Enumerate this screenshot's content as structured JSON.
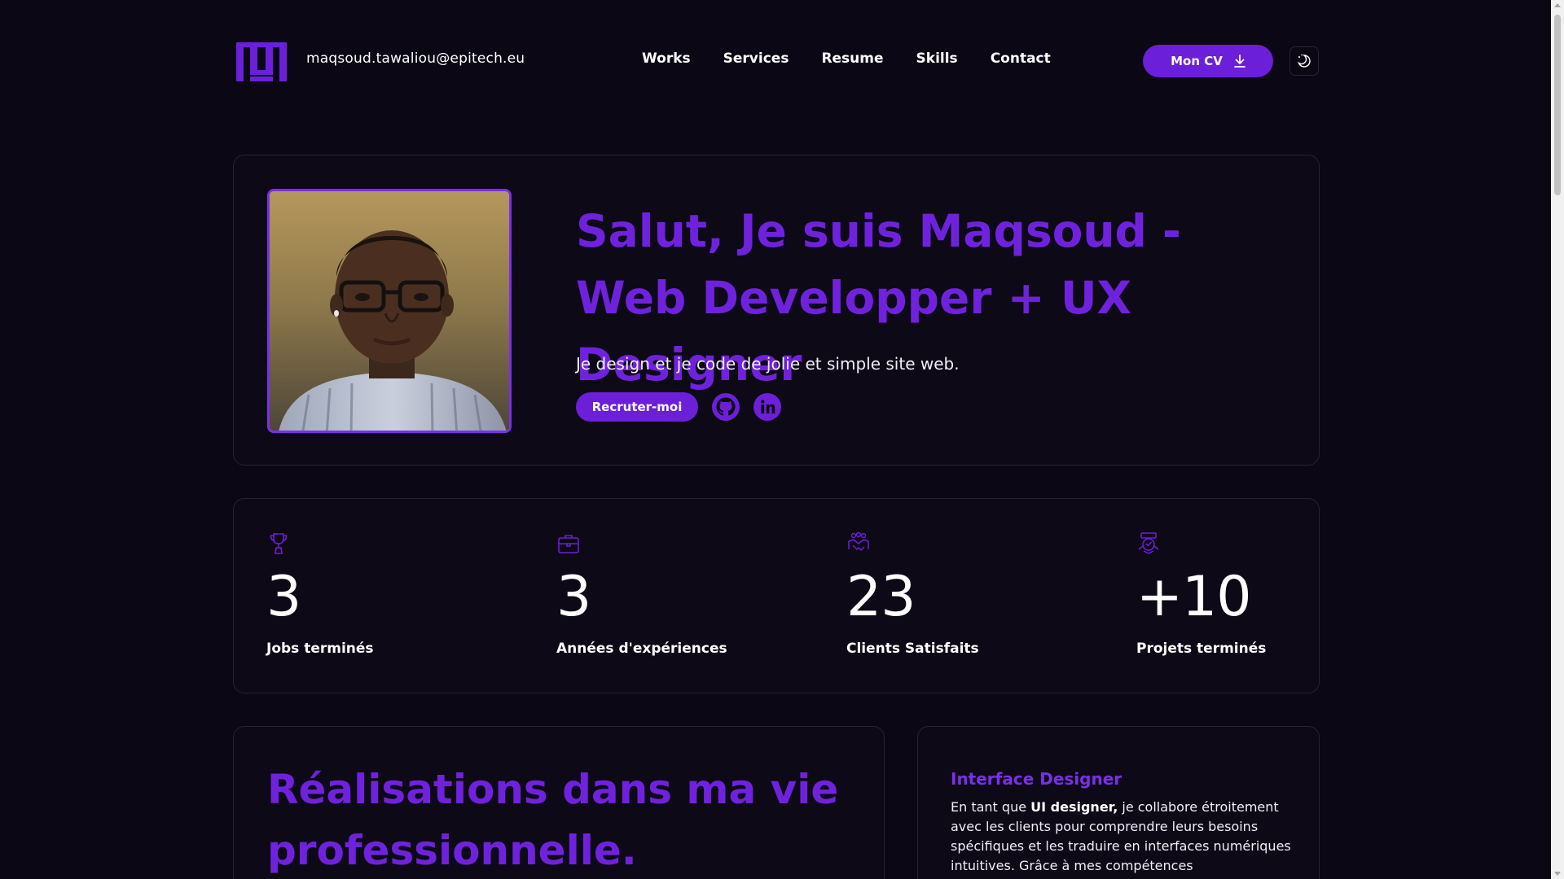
{
  "header": {
    "email": "maqsoud.tawaliou@epitech.eu",
    "nav": [
      "Works",
      "Services",
      "Resume",
      "Skills",
      "Contact"
    ],
    "cv_label": "Mon CV",
    "cv_icon": "download-icon",
    "theme_icon": "theme-toggle-icon"
  },
  "hero": {
    "title": "Salut, Je suis Maqsoud - Web Developper + UX Designer",
    "subtitle": "Je design et je code de jolie et simple site web.",
    "hire_label": "Recruter-moi",
    "social_icons": [
      "github-icon",
      "linkedin-icon"
    ]
  },
  "stats": [
    {
      "icon": "trophy-icon",
      "value": "3",
      "label": "Jobs terminés"
    },
    {
      "icon": "briefcase-icon",
      "value": "3",
      "label": "Années d'expériences"
    },
    {
      "icon": "handshake-icon",
      "value": "23",
      "label": "Clients Satisfaits"
    },
    {
      "icon": "award-icon",
      "value": "+10",
      "label": "Projets terminés"
    }
  ],
  "achievements": {
    "title": "Réalisations dans ma vie professionnelle."
  },
  "service": {
    "title": "Interface Designer",
    "text_before": "En tant que ",
    "text_bold": "UI designer,",
    "text_after": " je collabore étroitement avec les clients pour comprendre leurs besoins spécifiques et les traduire en interfaces numériques intuitives. Grâce à mes compétences"
  },
  "colors": {
    "background": "#0b0714",
    "accent": "#6c1fd8",
    "card_border": "#2a2236"
  }
}
